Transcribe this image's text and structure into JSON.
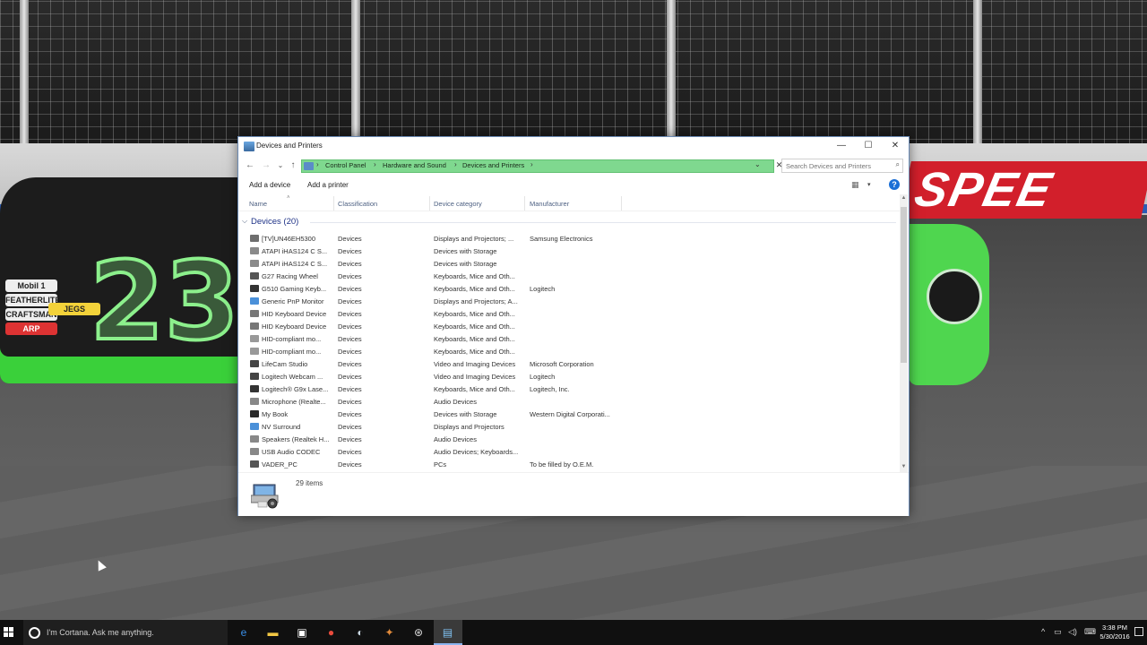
{
  "window": {
    "title": "Devices and Printers",
    "controls": {
      "minimize": "—",
      "maximize": "☐",
      "close": "✕"
    }
  },
  "nav": {
    "back": "←",
    "forward": "→",
    "recent": "⌄",
    "up": "↑"
  },
  "address": {
    "crumbs": [
      "Control Panel",
      "Hardware and Sound",
      "Devices and Printers"
    ],
    "separator": "›",
    "dropdown": "⌄",
    "clear": "✕"
  },
  "search": {
    "placeholder": "Search Devices and Printers",
    "icon": "⌕"
  },
  "commands": {
    "add_device": "Add a device",
    "add_printer": "Add a printer"
  },
  "toolbar_right": {
    "view": "▦",
    "view_arrow": "▾",
    "help": "?"
  },
  "columns": {
    "name": "Name",
    "classification": "Classification",
    "category": "Device category",
    "manufacturer": "Manufacturer"
  },
  "group": {
    "chevron": "⌵",
    "label": "Devices (20)"
  },
  "devices": [
    {
      "name": "[TV]UN46EH5300",
      "classification": "Devices",
      "category": "Displays and Projectors; ...",
      "manufacturer": "Samsung Electronics",
      "icon_color": "#6e6e6e"
    },
    {
      "name": "ATAPI iHAS124   C S...",
      "classification": "Devices",
      "category": "Devices with Storage",
      "manufacturer": "",
      "icon_color": "#8a8a8a"
    },
    {
      "name": "ATAPI iHAS124   C S...",
      "classification": "Devices",
      "category": "Devices with Storage",
      "manufacturer": "",
      "icon_color": "#8a8a8a"
    },
    {
      "name": "G27 Racing Wheel",
      "classification": "Devices",
      "category": "Keyboards, Mice and Oth...",
      "manufacturer": "",
      "icon_color": "#555555"
    },
    {
      "name": "G510 Gaming Keyb...",
      "classification": "Devices",
      "category": "Keyboards, Mice and Oth...",
      "manufacturer": "Logitech",
      "icon_color": "#333333"
    },
    {
      "name": "Generic PnP Monitor",
      "classification": "Devices",
      "category": "Displays and Projectors; A...",
      "manufacturer": "",
      "icon_color": "#4a90d9"
    },
    {
      "name": "HID Keyboard Device",
      "classification": "Devices",
      "category": "Keyboards, Mice and Oth...",
      "manufacturer": "",
      "icon_color": "#777777"
    },
    {
      "name": "HID Keyboard Device",
      "classification": "Devices",
      "category": "Keyboards, Mice and Oth...",
      "manufacturer": "",
      "icon_color": "#777777"
    },
    {
      "name": "HID-compliant mo...",
      "classification": "Devices",
      "category": "Keyboards, Mice and Oth...",
      "manufacturer": "",
      "icon_color": "#999999"
    },
    {
      "name": "HID-compliant mo...",
      "classification": "Devices",
      "category": "Keyboards, Mice and Oth...",
      "manufacturer": "",
      "icon_color": "#999999"
    },
    {
      "name": "LifeCam Studio",
      "classification": "Devices",
      "category": "Video and Imaging Devices",
      "manufacturer": "Microsoft Corporation",
      "icon_color": "#444444"
    },
    {
      "name": "Logitech Webcam ...",
      "classification": "Devices",
      "category": "Video and Imaging Devices",
      "manufacturer": "Logitech",
      "icon_color": "#444444"
    },
    {
      "name": "Logitech® G9x Lase...",
      "classification": "Devices",
      "category": "Keyboards, Mice and Oth...",
      "manufacturer": "Logitech, Inc.",
      "icon_color": "#333333"
    },
    {
      "name": "Microphone (Realte...",
      "classification": "Devices",
      "category": "Audio Devices",
      "manufacturer": "",
      "icon_color": "#888888"
    },
    {
      "name": "My Book",
      "classification": "Devices",
      "category": "Devices with Storage",
      "manufacturer": "Western Digital Corporati...",
      "icon_color": "#2a2a2a"
    },
    {
      "name": "NV Surround",
      "classification": "Devices",
      "category": "Displays and Projectors",
      "manufacturer": "",
      "icon_color": "#4a90d9"
    },
    {
      "name": "Speakers (Realtek H...",
      "classification": "Devices",
      "category": "Audio Devices",
      "manufacturer": "",
      "icon_color": "#888888"
    },
    {
      "name": "USB Audio CODEC",
      "classification": "Devices",
      "category": "Audio Devices; Keyboards...",
      "manufacturer": "",
      "icon_color": "#888888"
    },
    {
      "name": "VADER_PC",
      "classification": "Devices",
      "category": "PCs",
      "manufacturer": "To be filled by O.E.M.",
      "icon_color": "#555555"
    }
  ],
  "details": {
    "count": "29 items"
  },
  "taskbar": {
    "cortana_text": "I'm Cortana. Ask me anything.",
    "apps": [
      {
        "icon": "edge-icon",
        "glyph": "e",
        "color": "#3a8ee6"
      },
      {
        "icon": "file-explorer-icon",
        "glyph": "▬",
        "color": "#f2c744"
      },
      {
        "icon": "store-icon",
        "glyph": "▣",
        "color": "#ffffff"
      },
      {
        "icon": "chrome-icon",
        "glyph": "●",
        "color": "#e94b3c"
      },
      {
        "icon": "steam-icon",
        "glyph": "◐",
        "color": "#c7d5e0"
      },
      {
        "icon": "game-icon",
        "glyph": "✦",
        "color": "#e08a3a"
      },
      {
        "icon": "wheel-icon",
        "glyph": "⊛",
        "color": "#dddddd"
      },
      {
        "icon": "devices-printers-icon",
        "glyph": "▤",
        "color": "#7fc0f0"
      }
    ],
    "tray": {
      "chevron": "^",
      "network": "▭",
      "volume": "◁)",
      "keyboard": "⌨"
    },
    "time": "3:38 PM",
    "date": "5/30/2016"
  },
  "background": {
    "banner_text": "SPEE",
    "car_number": "23",
    "sponsors": [
      "Mobil 1",
      "FEATHERLITE",
      "CRAFTSMAN",
      "ARP",
      "JEGS"
    ]
  }
}
